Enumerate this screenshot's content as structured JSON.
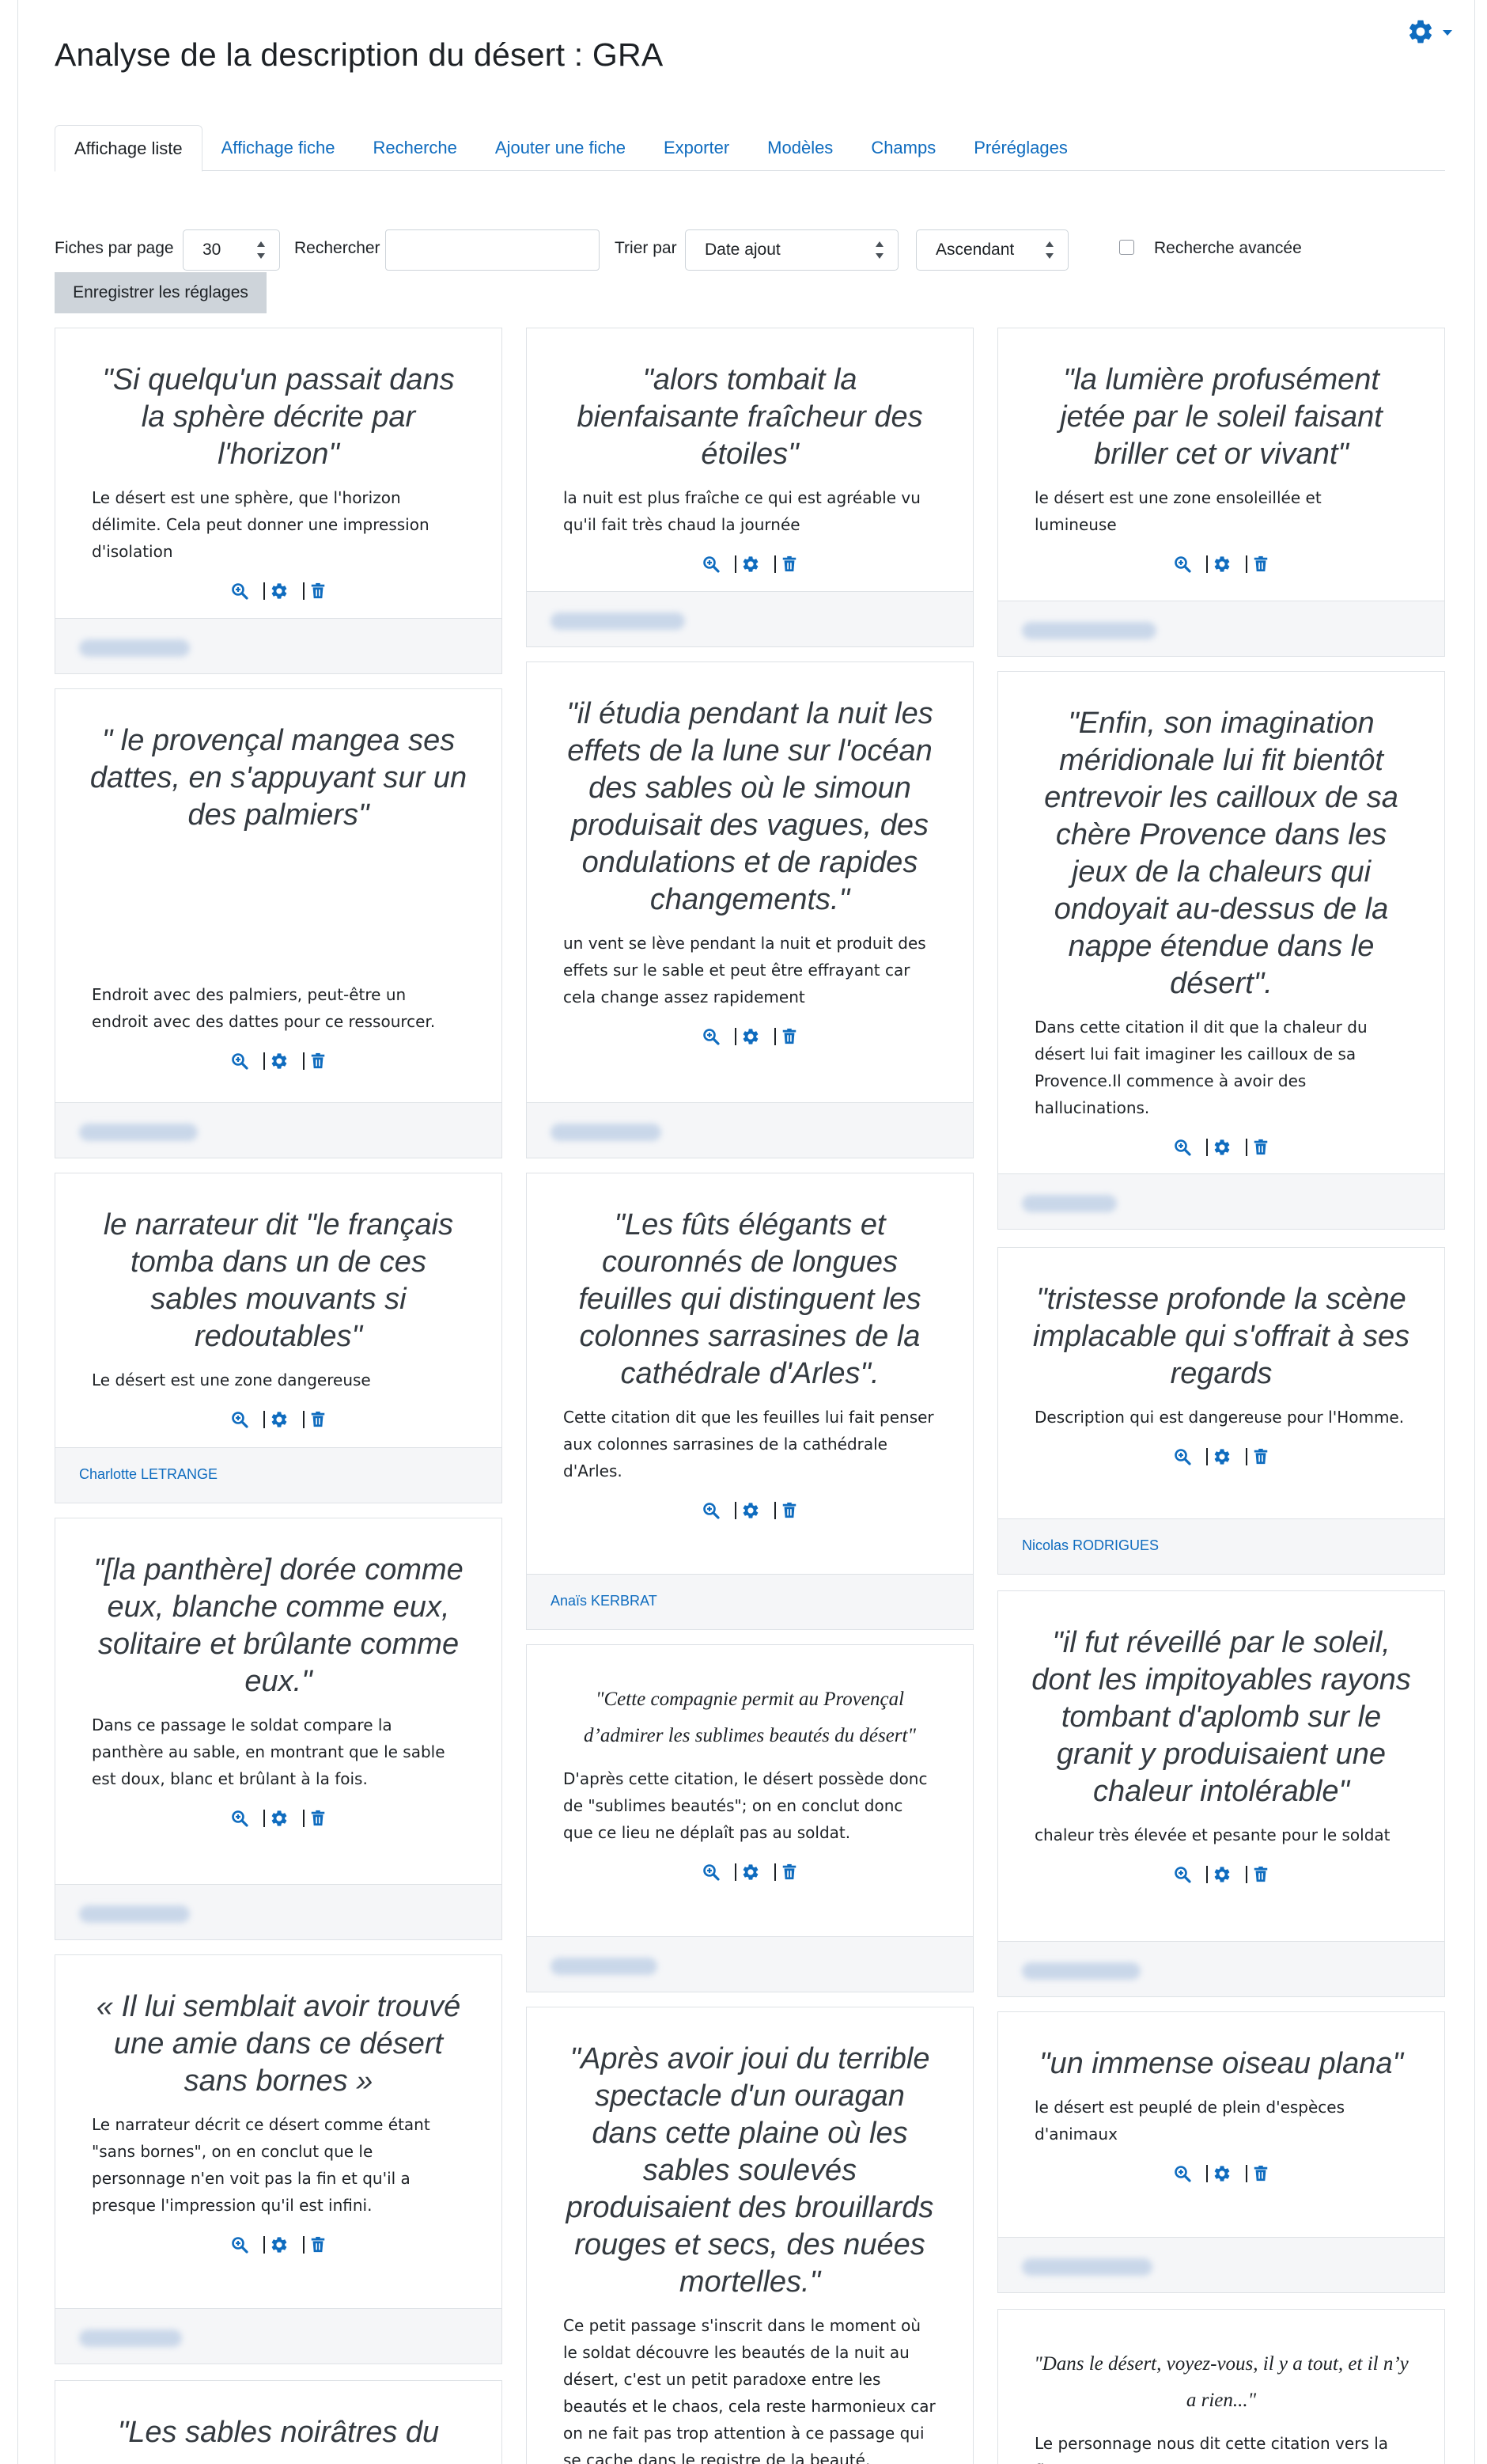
{
  "page": {
    "title": "Analyse de la description du désert : GRA"
  },
  "tabs": [
    {
      "label": "Affichage liste",
      "active": true
    },
    {
      "label": "Affichage fiche"
    },
    {
      "label": "Recherche"
    },
    {
      "label": "Ajouter une fiche"
    },
    {
      "label": "Exporter"
    },
    {
      "label": "Modèles"
    },
    {
      "label": "Champs"
    },
    {
      "label": "Préréglages"
    }
  ],
  "controls": {
    "per_page_label": "Fiches par page",
    "per_page_value": "30",
    "search_label": "Rechercher",
    "search_value": "",
    "sort_label": "Trier par",
    "sort_value": "Date ajout",
    "order_value": "Ascendant",
    "advanced_label": "Recherche avancée",
    "advanced_checked": false,
    "save_label": "Enregistrer les réglages"
  },
  "colors": {
    "link": "#0f6cbf",
    "footer_bg": "#f5f6f8",
    "border": "#dee2e6"
  },
  "icons": {
    "view": "magnifier-plus-icon",
    "edit": "gear-icon",
    "delete": "trash-icon"
  },
  "cards": [
    {
      "quote": "\"Si quelqu'un passait dans la sphère décrite par l'horizon\"",
      "desc": "Le désert est une sphère, que l'horizon délimite. Cela peut donner une impression d'isolation",
      "author": ""
    },
    {
      "quote": "\"alors tombait la bienfaisante fraîcheur des étoiles\"",
      "desc": "la nuit est plus fraîche ce qui est agréable vu qu'il fait très chaud la journée",
      "author": ""
    },
    {
      "quote": "\"la lumière profusément jetée par le soleil faisant briller cet or vivant\"",
      "desc": "le désert est une zone ensoleillée et lumineuse",
      "author": ""
    },
    {
      "quote": "\" le provençal mangea ses dattes, en s'appuyant sur un des palmiers\"",
      "desc": "Endroit avec des palmiers, peut-être un endroit avec des dattes pour ce ressourcer.",
      "author": ""
    },
    {
      "quote": "\"il étudia pendant la nuit les effets de la lune sur l'océan des sables où le simoun produisait des vagues, des ondulations et de rapides changements.\"",
      "desc": "un vent se lève pendant la nuit et produit des effets sur le sable et peut être effrayant car cela change assez rapidement",
      "author": ""
    },
    {
      "quote": "\"Enfin, son imagination méridionale lui fit bientôt entrevoir les cailloux de sa chère Provence dans les jeux de la chaleurs qui ondoyait au-dessus de la nappe étendue dans le désert\".",
      "desc": "Dans cette citation il dit que la chaleur du désert lui fait imaginer les cailloux de sa Provence.Il commence à avoir des hallucinations.",
      "author": ""
    },
    {
      "quote": "le narrateur dit \"le français tomba dans un de ces sables mouvants si redoutables\"",
      "desc": "Le désert est une zone dangereuse",
      "author": "Charlotte LETRANGE"
    },
    {
      "quote": "\"Les fûts élégants et couronnés de longues feuilles qui distinguent les colonnes sarrasines de la cathédrale d'Arles\".",
      "desc": "Cette citation dit que les feuilles lui fait penser aux colonnes sarrasines de la cathédrale d'Arles.",
      "author": "Anaïs KERBRAT"
    },
    {
      "quote": "\"tristesse profonde la scène implacable qui s'offrait à ses regards",
      "desc": "Description qui est dangereuse pour l'Homme.",
      "author": "Nicolas RODRIGUES"
    },
    {
      "quote": "\"[la panthère] dorée comme eux, blanche comme eux, solitaire et brûlante comme eux.\"",
      "desc": "Dans ce passage le soldat compare la panthère au sable, en montrant que le sable est doux, blanc et brûlant à la fois.",
      "author": ""
    },
    {
      "quote": "\"Cette compagnie permit au Provençal d’admirer les sublimes beautés du désert\"",
      "desc": "D'après cette citation, le désert possède donc de \"sublimes beautés\"; on en conclut donc que ce lieu ne déplaît pas au soldat.",
      "author": ""
    },
    {
      "quote": "\"il fut réveillé par le soleil, dont les impitoyables rayons tombant d'aplomb sur le granit y produisaient une chaleur intolérable\"",
      "desc": "chaleur très élevée et pesante pour le soldat",
      "author": ""
    },
    {
      "quote": "« Il lui semblait avoir trouvé une amie dans ce désert sans bornes »",
      "desc": "Le narrateur décrit ce désert comme étant \"sans bornes\", on en conclut que le personnage n'en voit pas la fin et qu'il a presque l'impression qu'il est infini.",
      "author": ""
    },
    {
      "quote": "\"Après avoir joui du terrible spectacle d'un ouragan dans cette plaine où les sables soulevés produisaient des brouillards rouges et secs, des nuées mortelles.\"",
      "desc": "Ce petit passage s'inscrit dans le moment où le soldat découvre les beautés de la nuit au désert, c'est un petit paradoxe entre les beautés et le chaos, cela reste harmonieux car on ne fait pas trop attention à ce passage qui se cache dans le registre de la beauté.",
      "author": ""
    },
    {
      "quote": "\"un immense oiseau plana\"",
      "desc": "le désert est peuplé de plein d'espèces d'animaux",
      "author": ""
    },
    {
      "quote": "\"Les sables noirâtres du",
      "desc": "",
      "author": ""
    },
    {
      "quote": "\"Dans le désert, voyez-vous, il y a tout, et il n’y a rien...\"",
      "desc": "Le personnage nous dit cette citation vers la fin",
      "author": ""
    }
  ]
}
